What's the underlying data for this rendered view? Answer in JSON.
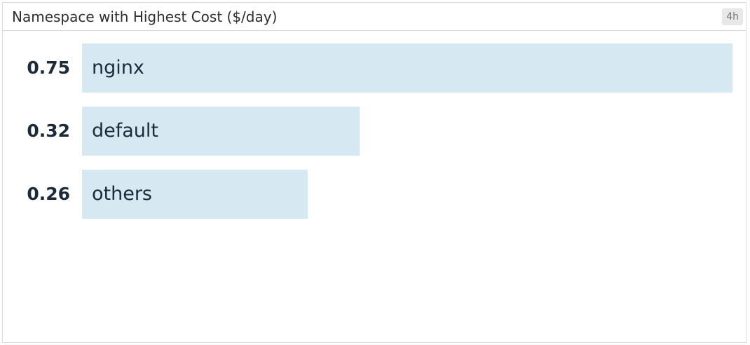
{
  "widget": {
    "title": "Namespace with Highest Cost ($/day)",
    "timeframe": "4h"
  },
  "colors": {
    "bar": "#d6e9f2",
    "value_text": "#1c2b39",
    "border": "#dcdcdc"
  },
  "chart_data": {
    "type": "bar",
    "orientation": "horizontal",
    "title": "Namespace with Highest Cost ($/day)",
    "categories": [
      "nginx",
      "default",
      "others"
    ],
    "values": [
      0.75,
      0.32,
      0.26
    ],
    "value_labels": [
      "0.75",
      "0.32",
      "0.26"
    ],
    "xlim": [
      0,
      0.75
    ],
    "grid": false,
    "legend": "none"
  }
}
